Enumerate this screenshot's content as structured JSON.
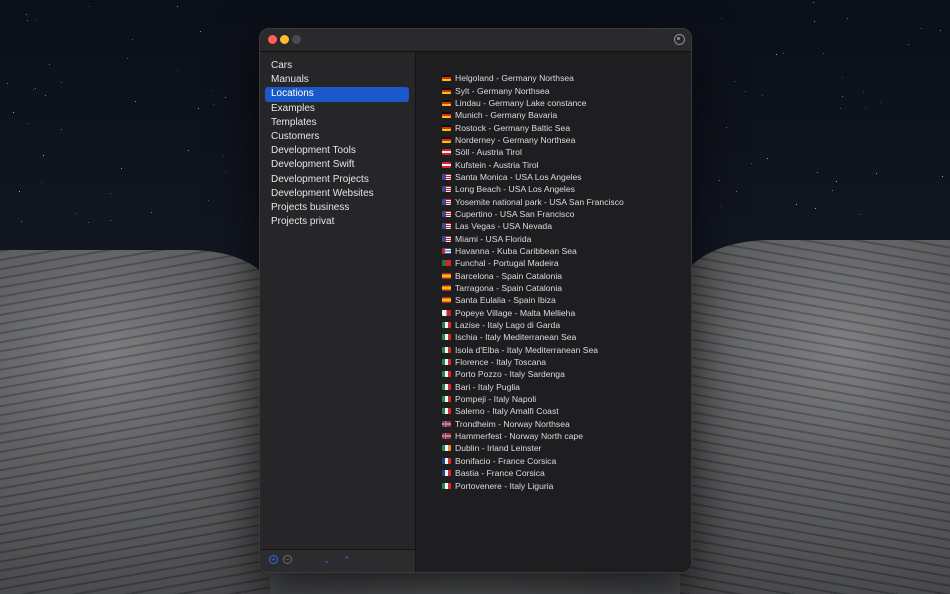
{
  "sidebar": {
    "items": [
      {
        "label": "Cars"
      },
      {
        "label": "Manuals"
      },
      {
        "label": "Locations",
        "selected": true
      },
      {
        "label": "Examples"
      },
      {
        "label": "Templates"
      },
      {
        "label": "Customers"
      },
      {
        "label": "Development Tools"
      },
      {
        "label": "Development Swift"
      },
      {
        "label": "Development Projects"
      },
      {
        "label": "Development Websites"
      },
      {
        "label": "Projects business"
      },
      {
        "label": "Projects privat"
      }
    ],
    "bottom_bar": {
      "add_icon": "plus-circle-icon",
      "remove_icon": "minus-circle-icon",
      "move_down_icon": "chevron-down-icon",
      "move_up_icon": "chevron-up-icon",
      "add_glyph": "+",
      "remove_glyph": "−",
      "down_glyph": "⌄",
      "up_glyph": "⌃"
    }
  },
  "colors": {
    "selection": "#1b58c9",
    "accent": "#2f6de0"
  },
  "locations": [
    {
      "flag": "de",
      "text": "Helgoland - Germany Northsea"
    },
    {
      "flag": "de",
      "text": "Sylt - Germany Northsea"
    },
    {
      "flag": "de",
      "text": "Lindau - Germany Lake constance"
    },
    {
      "flag": "de",
      "text": "Munich - Germany Bavaria"
    },
    {
      "flag": "de",
      "text": "Rostock - Germany Baltic Sea"
    },
    {
      "flag": "de",
      "text": "Norderney - Germany Northsea"
    },
    {
      "flag": "at",
      "text": "Söll - Austria Tirol"
    },
    {
      "flag": "at",
      "text": "Kufstein - Austria Tirol"
    },
    {
      "flag": "us",
      "text": "Santa Monica - USA Los Angeles"
    },
    {
      "flag": "us",
      "text": "Long Beach - USA Los Angeles"
    },
    {
      "flag": "us",
      "text": "Yosemite national park - USA San Francisco"
    },
    {
      "flag": "us",
      "text": "Cupertino - USA San Francisco"
    },
    {
      "flag": "us",
      "text": "Las Vegas - USA Nevada"
    },
    {
      "flag": "us",
      "text": "Miami - USA Florida"
    },
    {
      "flag": "cu",
      "text": "Havanna - Kuba Caribbean Sea"
    },
    {
      "flag": "pt",
      "text": "Funchal - Portugal Madeira"
    },
    {
      "flag": "es",
      "text": "Barcelona - Spain Catalonia"
    },
    {
      "flag": "es",
      "text": "Tarragona - Spain Catalonia"
    },
    {
      "flag": "es",
      "text": "Santa Eulalia - Spain Ibiza"
    },
    {
      "flag": "mt",
      "text": "Popeye Village - Malta Mellieha"
    },
    {
      "flag": "it",
      "text": "Lazise - Italy Lago di Garda"
    },
    {
      "flag": "it",
      "text": "Ischia - Italy Mediterranean Sea"
    },
    {
      "flag": "it",
      "text": "Isola d'Elba - Italy Mediterranean Sea"
    },
    {
      "flag": "it",
      "text": "Florence - Italy Toscana"
    },
    {
      "flag": "it",
      "text": "Porto Pozzo - Italy Sardenga"
    },
    {
      "flag": "it",
      "text": "Bari - Italy Puglia"
    },
    {
      "flag": "it",
      "text": "Pompeji - Italy Napoli"
    },
    {
      "flag": "it",
      "text": "Salerno - Italy Amalfi Coast"
    },
    {
      "flag": "no",
      "text": "Trondheim - Norway Northsea"
    },
    {
      "flag": "no",
      "text": "Hammerfest - Norway North cape"
    },
    {
      "flag": "ie",
      "text": "Dublin - Irland Leinster"
    },
    {
      "flag": "fr",
      "text": "Bonifacio - France Corsica"
    },
    {
      "flag": "fr",
      "text": "Bastia - France Corsica"
    },
    {
      "flag": "it",
      "text": "Portovenere - Italy Liguria"
    }
  ]
}
